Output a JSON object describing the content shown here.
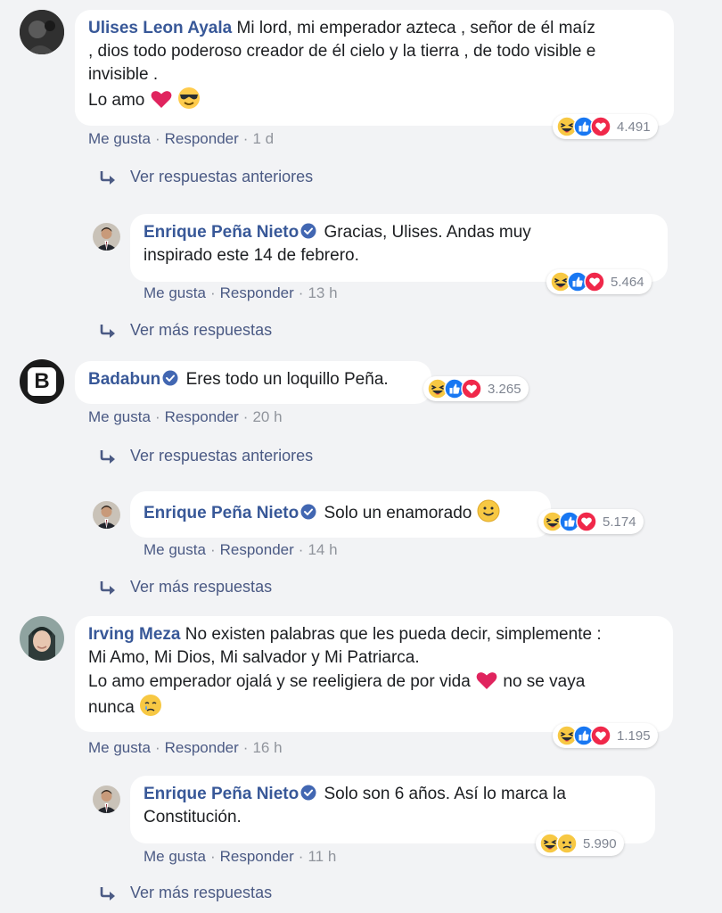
{
  "comments": [
    {
      "author": "Ulises Leon Ayala",
      "text_1": "Mi lord, mi emperador azteca , señor de él maíz",
      "text_2": ", dios todo poderoso creador de él cielo y la tierra , de todo visible e",
      "text_3": "invisible .",
      "text_4": "Lo amo",
      "like": "Me gusta",
      "reply": "Responder",
      "time": "1 d",
      "reactions": "4.491",
      "more": "Ver respuestas anteriores"
    },
    {
      "author": "Enrique Peña Nieto",
      "text_1": "Gracias, Ulises. Andas muy",
      "text_2": "inspirado este 14 de febrero.",
      "like": "Me gusta",
      "reply": "Responder",
      "time": "13 h",
      "reactions": "5.464",
      "more": "Ver más respuestas"
    },
    {
      "author": "Badabun",
      "text_1": "Eres todo un loquillo Peña.",
      "like": "Me gusta",
      "reply": "Responder",
      "time": "20 h",
      "reactions": "3.265",
      "more": "Ver respuestas anteriores"
    },
    {
      "author": "Enrique Peña Nieto",
      "text_1": "Solo un enamorado",
      "like": "Me gusta",
      "reply": "Responder",
      "time": "14 h",
      "reactions": "5.174",
      "more": "Ver más respuestas"
    },
    {
      "author": "Irving Meza",
      "text_1": "No existen palabras que les pueda decir, simplemente :",
      "text_2": "Mi Amo, Mi Dios, Mi salvador y Mi Patriarca.",
      "text_3": "Lo amo emperador ojalá y se reeligiera de por vida",
      "text_3b": "no se vaya",
      "text_4": "nunca",
      "like": "Me gusta",
      "reply": "Responder",
      "time": "16 h",
      "reactions": "1.195"
    },
    {
      "author": "Enrique Peña Nieto",
      "text_1": "Solo son 6 años. Así lo marca la",
      "text_2": "Constitución.",
      "like": "Me gusta",
      "reply": "Responder",
      "time": "11 h",
      "reactions": "5.990",
      "more": "Ver más respuestas"
    }
  ],
  "badabun_avatar_letter": "B",
  "colors": {
    "author": "#385898",
    "link": "#4b5a84",
    "muted": "#90949c",
    "like_blue": "#1877f2",
    "love_red": "#f0284a",
    "haha_yellow": "#f7c843"
  }
}
